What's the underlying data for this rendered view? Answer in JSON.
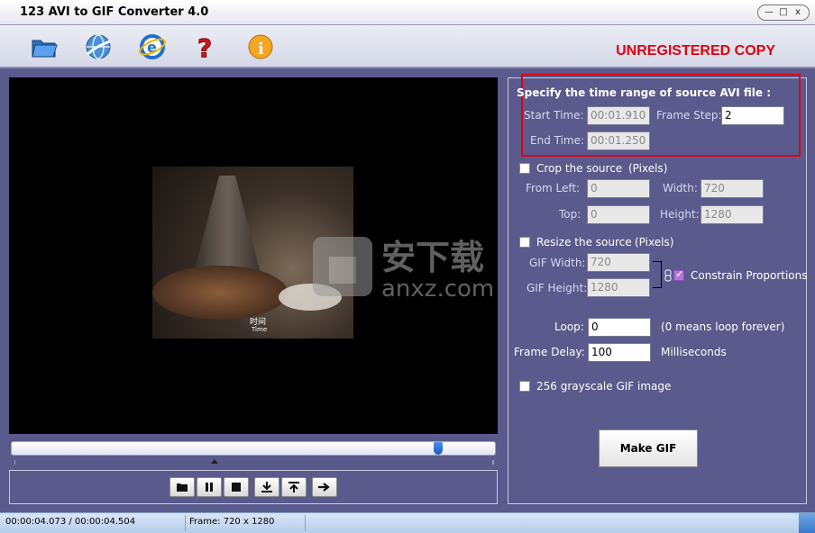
{
  "window": {
    "title": "123 AVI to GIF Converter 4.0",
    "buttons": {
      "minimize": "—",
      "maximize": "□",
      "close": "x"
    }
  },
  "toolbar": {
    "icons": [
      "open-folder-icon",
      "web-update-icon",
      "internet-explorer-icon",
      "help-icon",
      "info-icon"
    ],
    "unregistered": "UNREGISTERED COPY"
  },
  "video": {
    "caption_zh": "时间",
    "caption_en": "Time",
    "watermark_text": "安下载",
    "watermark_domain": "anxz.com"
  },
  "playback": {
    "seek_position": 0.89,
    "buttons": [
      "open-folder-icon",
      "pause-icon",
      "stop-icon",
      "mark-start-icon",
      "mark-end-icon",
      "next-icon"
    ]
  },
  "time_range": {
    "heading": "Specify the time range of source AVI file :",
    "start_label": "Start Time:",
    "start_value": "00:01.910",
    "frame_step_label": "Frame Step:",
    "frame_step_value": "2",
    "end_label": "End Time:",
    "end_value": "00:01.250"
  },
  "crop": {
    "checkbox_label": "Crop the source",
    "unit": "(Pixels)",
    "checked": false,
    "from_left_label": "From  Left:",
    "from_left_value": "0",
    "width_label": "Width:",
    "width_value": "720",
    "top_label": "Top:",
    "top_value": "0",
    "height_label": "Height:",
    "height_value": "1280"
  },
  "resize": {
    "checkbox_label": "Resize the source",
    "unit": "(Pixels)",
    "checked": false,
    "gif_width_label": "GIF Width:",
    "gif_width_value": "720",
    "gif_height_label": "GIF Height:",
    "gif_height_value": "1280",
    "constrain_label": "Constrain Proportions",
    "constrain_checked": true
  },
  "loop": {
    "label": "Loop:",
    "value": "0",
    "hint": "(0 means loop forever)"
  },
  "frame_delay": {
    "label": "Frame Delay:",
    "value": "100",
    "unit": "Milliseconds"
  },
  "grayscale": {
    "label": "256 grayscale GIF image",
    "checked": false
  },
  "make_gif_label": "Make GIF",
  "status": {
    "time": "00:00:04.073 / 00:00:04.504",
    "frame": "Frame: 720 x 1280"
  }
}
